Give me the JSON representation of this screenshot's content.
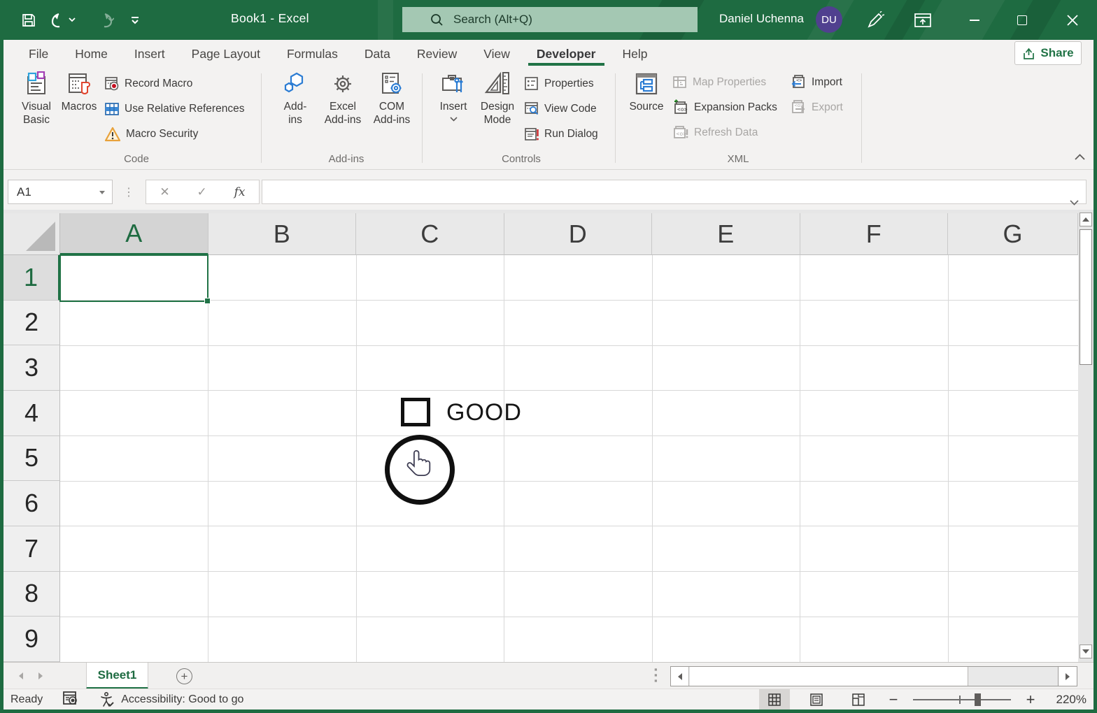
{
  "titlebar": {
    "title": "Book1  -  Excel",
    "search_placeholder": "Search (Alt+Q)",
    "user_name": "Daniel Uchenna",
    "user_initials": "DU"
  },
  "tabs": [
    {
      "label": "File",
      "active": false
    },
    {
      "label": "Home",
      "active": false
    },
    {
      "label": "Insert",
      "active": false
    },
    {
      "label": "Page Layout",
      "active": false
    },
    {
      "label": "Formulas",
      "active": false
    },
    {
      "label": "Data",
      "active": false
    },
    {
      "label": "Review",
      "active": false
    },
    {
      "label": "View",
      "active": false
    },
    {
      "label": "Developer",
      "active": true
    },
    {
      "label": "Help",
      "active": false
    }
  ],
  "share": {
    "label": "Share"
  },
  "ribbon": {
    "code": {
      "group_label": "Code",
      "visual_basic": "Visual\nBasic",
      "macros": "Macros",
      "record_macro": "Record Macro",
      "use_relative_references": "Use Relative References",
      "macro_security": "Macro Security"
    },
    "addins": {
      "group_label": "Add-ins",
      "add_ins": "Add-\nins",
      "excel_add_ins": "Excel\nAdd-ins",
      "com_add_ins": "COM\nAdd-ins"
    },
    "controls": {
      "group_label": "Controls",
      "insert": "Insert",
      "design_mode": "Design\nMode",
      "properties": "Properties",
      "view_code": "View Code",
      "run_dialog": "Run Dialog"
    },
    "xml": {
      "group_label": "XML",
      "source": "Source",
      "map_properties": "Map Properties",
      "expansion_packs": "Expansion Packs",
      "refresh_data": "Refresh Data",
      "import": "Import",
      "export": "Export"
    }
  },
  "formula_bar": {
    "name_box_value": "A1",
    "fx_label": "fx"
  },
  "grid": {
    "columns": [
      "A",
      "B",
      "C",
      "D",
      "E",
      "F",
      "G"
    ],
    "rows": [
      "1",
      "2",
      "3",
      "4",
      "5",
      "6",
      "7",
      "8",
      "9"
    ],
    "selected_column": "A",
    "selected_row": "1",
    "checkbox_label": "GOOD"
  },
  "sheet_bar": {
    "active_sheet": "Sheet1",
    "add_sheet_glyph": "+"
  },
  "status_bar": {
    "ready": "Ready",
    "accessibility": "Accessibility: Good to go",
    "zoom_level": "220%"
  },
  "colors": {
    "titlebar_green": "#1E6B41",
    "accent_green": "#217346",
    "avatar_purple": "#50408F"
  }
}
